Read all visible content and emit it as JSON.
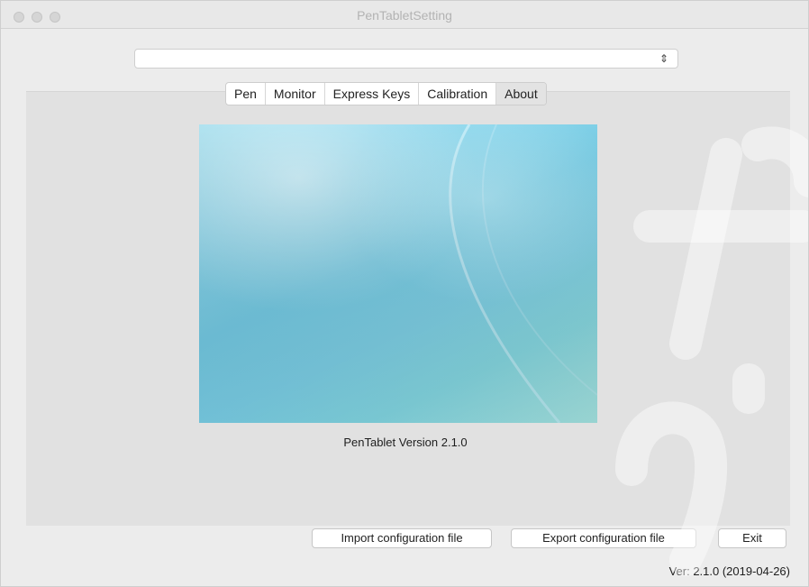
{
  "window": {
    "title": "PenTabletSetting"
  },
  "device_select": {
    "value": ""
  },
  "tabs": [
    {
      "label": "Pen",
      "active": false
    },
    {
      "label": "Monitor",
      "active": false
    },
    {
      "label": "Express Keys",
      "active": false
    },
    {
      "label": "Calibration",
      "active": false
    },
    {
      "label": "About",
      "active": true
    }
  ],
  "about": {
    "version_text": "PenTablet Version  2.1.0"
  },
  "buttons": {
    "import_label": "Import configuration file",
    "export_label": "Export configuration file",
    "exit_label": "Exit"
  },
  "footer": {
    "version": "Ver: 2.1.0 (2019-04-26)"
  },
  "icons": {
    "close": "close-icon",
    "minimize": "minimize-icon",
    "zoom": "zoom-icon",
    "select_arrows": "up-down-arrows-icon"
  },
  "colors": {
    "window_bg": "#ececec",
    "tab_content_bg": "#e1e1e1",
    "active_tab_bg": "#e3e3e3",
    "image_teal": "#79cde5"
  }
}
